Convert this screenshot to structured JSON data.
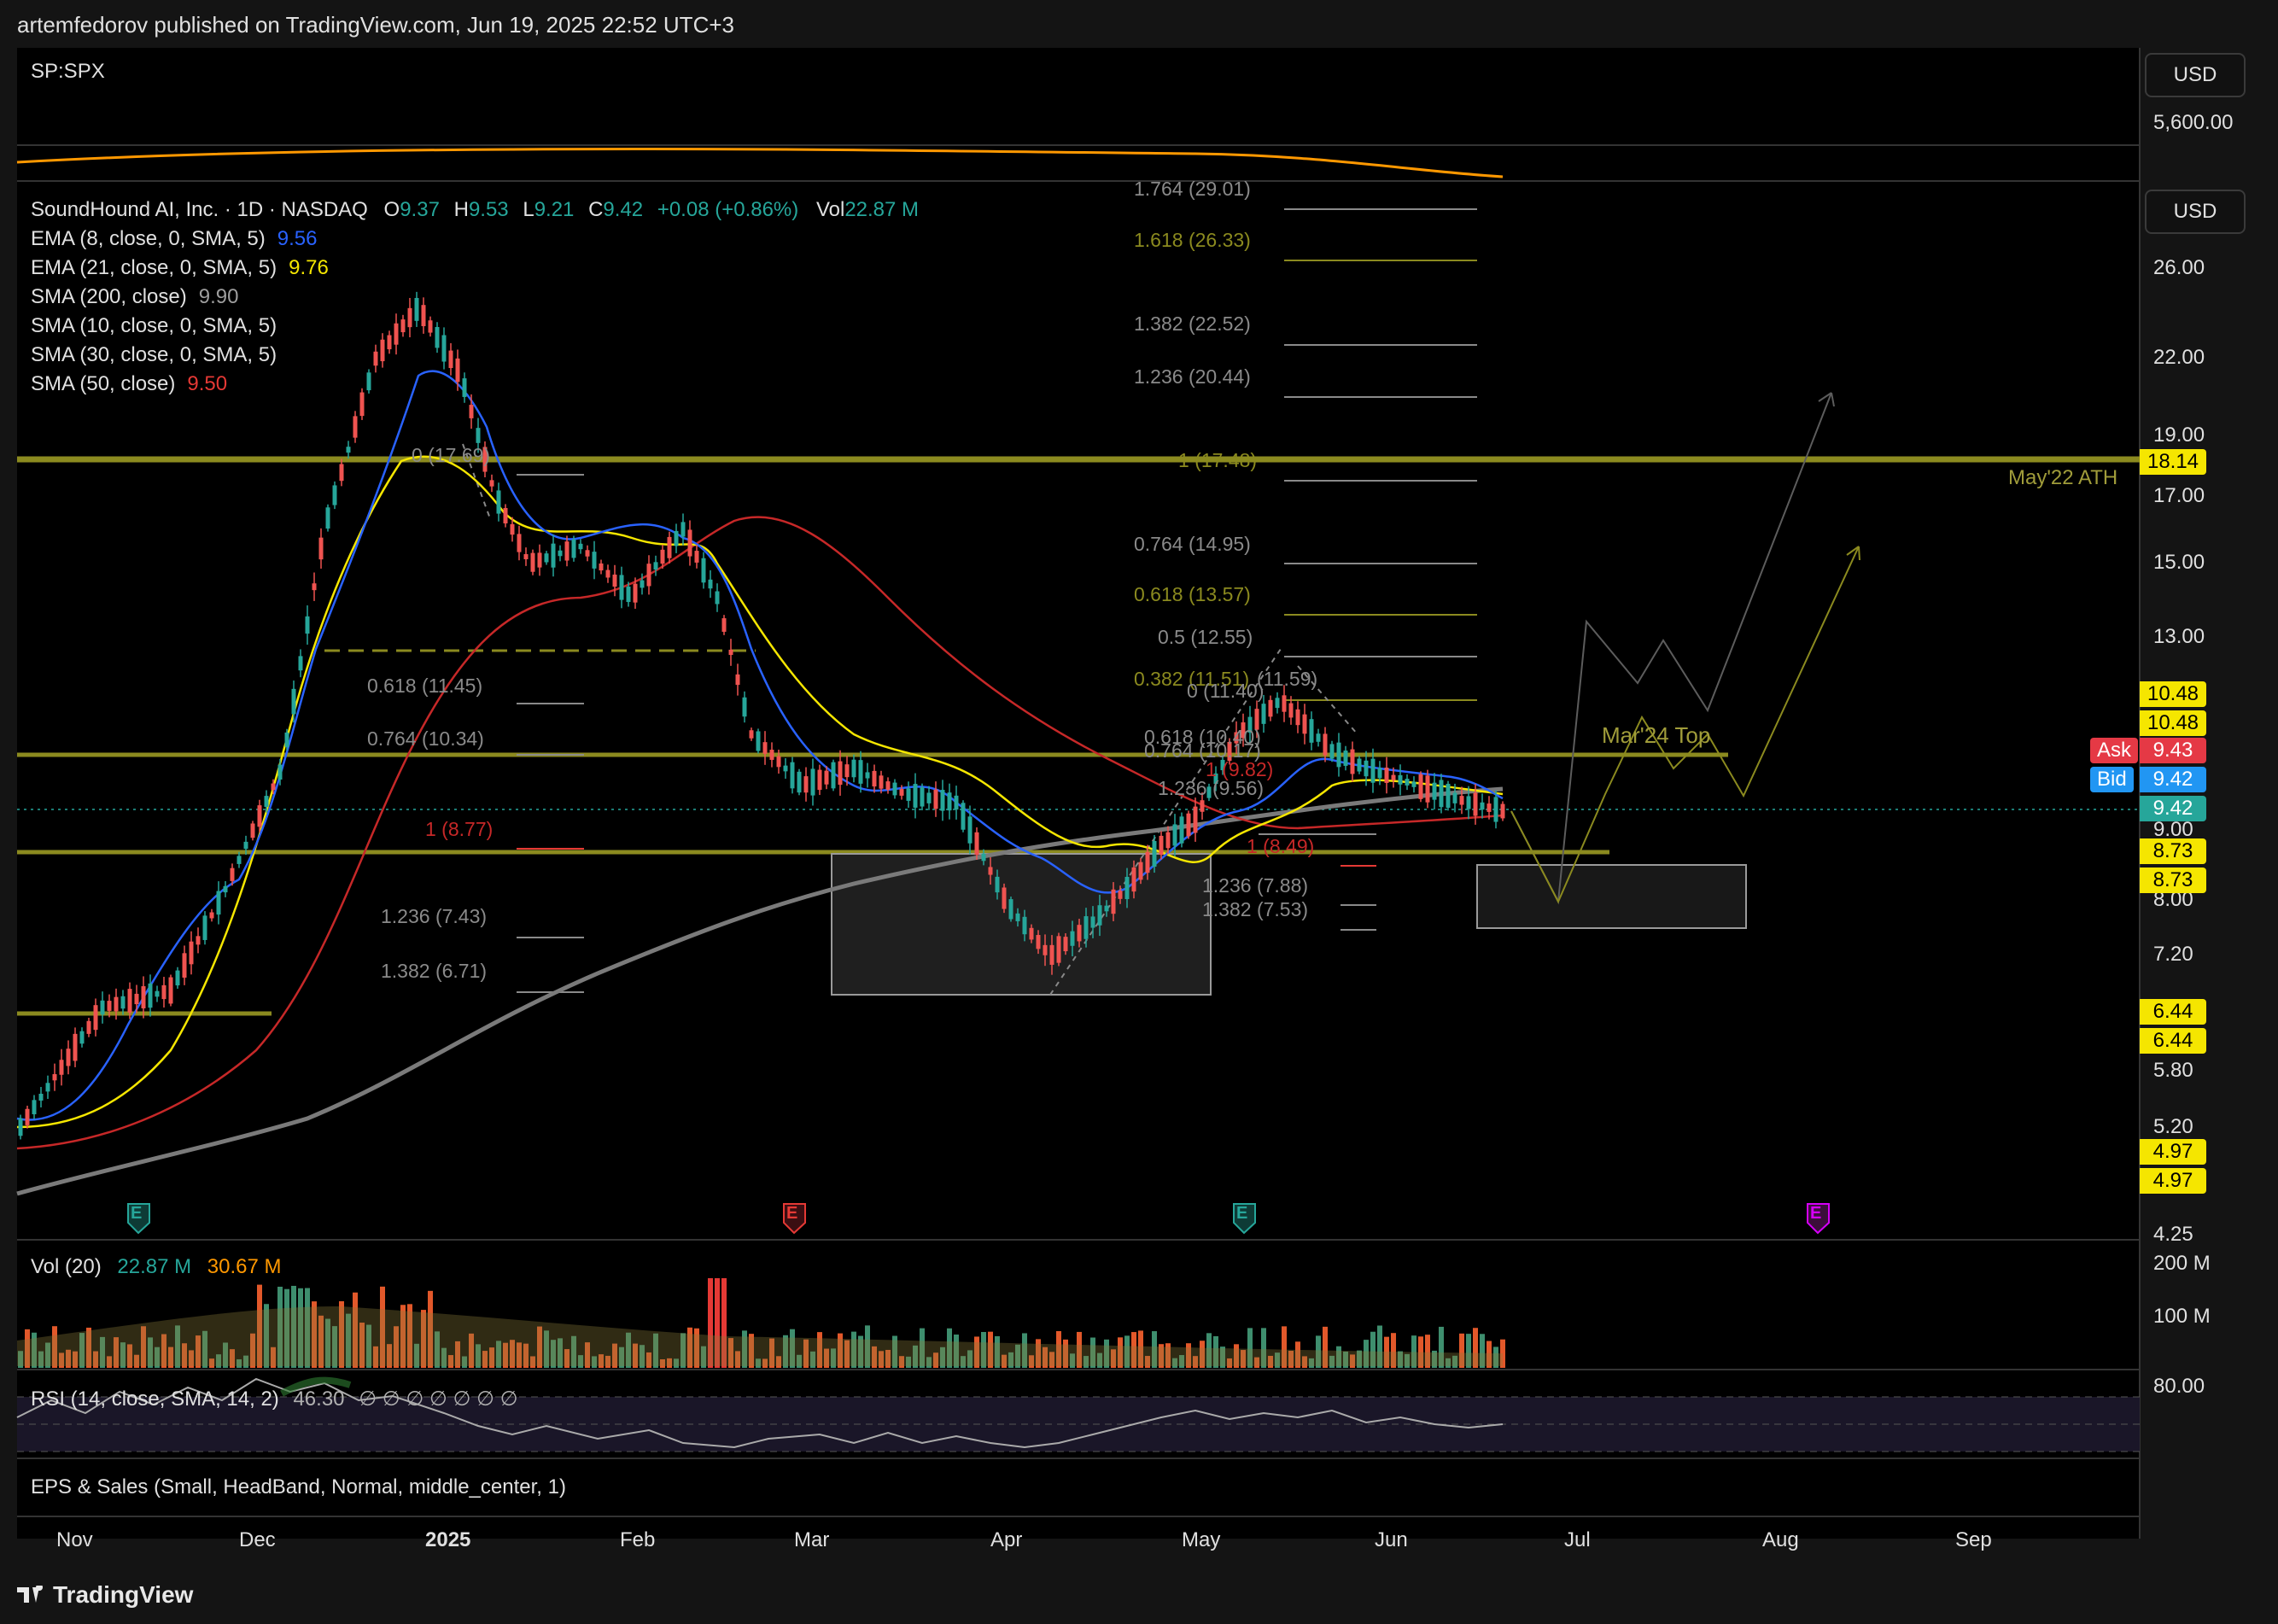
{
  "header": {
    "published": "artemfedorov published on TradingView.com, Jun 19, 2025 22:52 UTC+3"
  },
  "top_pane": {
    "symbol": "SP:SPX",
    "currency": "USD",
    "price_label": "5,600.00"
  },
  "main": {
    "currency": "USD",
    "title": "SoundHound AI, Inc. · 1D · NASDAQ",
    "ohlc": {
      "o_label": "O",
      "o": "9.37",
      "h_label": "H",
      "h": "9.53",
      "l_label": "L",
      "l": "9.21",
      "c_label": "C",
      "c": "9.42",
      "change": "+0.08 (+0.86%)",
      "vol_label": "Vol",
      "vol": "22.87 M"
    },
    "indicators": [
      {
        "label": "EMA (8, close, 0, SMA, 5)",
        "value": "9.56",
        "color": "#2962ff"
      },
      {
        "label": "EMA (21, close, 0, SMA, 5)",
        "value": "9.76",
        "color": "#f5e600"
      },
      {
        "label": "SMA (200, close)",
        "value": "9.90",
        "color": "#9e9e9e"
      },
      {
        "label": "SMA (10, close, 0, SMA, 5)",
        "value": "",
        "color": "#e0e0e0"
      },
      {
        "label": "SMA (30, close, 0, SMA, 5)",
        "value": "",
        "color": "#e0e0e0"
      },
      {
        "label": "SMA (50, close)",
        "value": "9.50",
        "color": "#e53935"
      }
    ],
    "annotations": {
      "ath": "May'22 ATH",
      "mar24": "Mar'24 Top"
    },
    "fib_labels": {
      "a": [
        "1.764 (29.01)",
        "1.618 (26.33)",
        "1.382 (22.52)",
        "1.236 (20.44)",
        "1 (17.48)",
        "0.764 (14.95)",
        "0.618 (13.57)",
        "0.5 (12.55)",
        "0.382 (11.51)",
        "0 (11.40)",
        "(11.59)"
      ],
      "b": [
        "0 (17.69)",
        "0.618 (11.45)",
        "0.764 (10.34)",
        "1 (8.77)",
        "1.236 (7.43)",
        "1.382 (6.71)"
      ],
      "c": [
        "0.618 (10.40)",
        "0.764 (10.17)",
        "1 (9.82)",
        "1.236 (9.56)",
        "1 (8.49)",
        "1.236 (7.88)",
        "1.382 (7.53)"
      ]
    },
    "y_axis": [
      "26.00",
      "22.00",
      "19.00",
      "17.00",
      "15.00",
      "13.00",
      "9.00",
      "8.00",
      "7.20",
      "5.80",
      "5.20",
      "4.25"
    ],
    "price_tags": [
      {
        "text": "18.14",
        "kind": "yellow"
      },
      {
        "text": "10.48",
        "kind": "yellow"
      },
      {
        "text": "10.48",
        "kind": "yellow"
      },
      {
        "text": "9.43",
        "kind": "ask",
        "label": "Ask"
      },
      {
        "text": "9.42",
        "kind": "bid",
        "label": "Bid"
      },
      {
        "text": "9.42",
        "kind": "last"
      },
      {
        "text": "8.73",
        "kind": "yellow"
      },
      {
        "text": "8.73",
        "kind": "yellow"
      },
      {
        "text": "6.44",
        "kind": "yellow"
      },
      {
        "text": "6.44",
        "kind": "yellow"
      },
      {
        "text": "4.97",
        "kind": "yellow"
      },
      {
        "text": "4.97",
        "kind": "yellow"
      }
    ],
    "earnings_marker": "E"
  },
  "volume": {
    "label": "Vol (20)",
    "v1": "22.87 M",
    "v2": "30.67 M",
    "axis": [
      "200 M",
      "100 M"
    ]
  },
  "rsi": {
    "label": "RSI (14, close, SMA, 14, 2)",
    "value": "46.30",
    "tail": "∅ ∅ ∅ ∅ ∅ ∅ ∅",
    "axis": "80.00"
  },
  "eps": {
    "label": "EPS & Sales (Small, HeadBand, Normal, middle_center, 1)"
  },
  "x_axis": [
    "Nov",
    "Dec",
    "2025",
    "Feb",
    "Mar",
    "Apr",
    "May",
    "Jun",
    "Jul",
    "Aug",
    "Sep"
  ],
  "footer": {
    "brand": "TradingView"
  }
}
